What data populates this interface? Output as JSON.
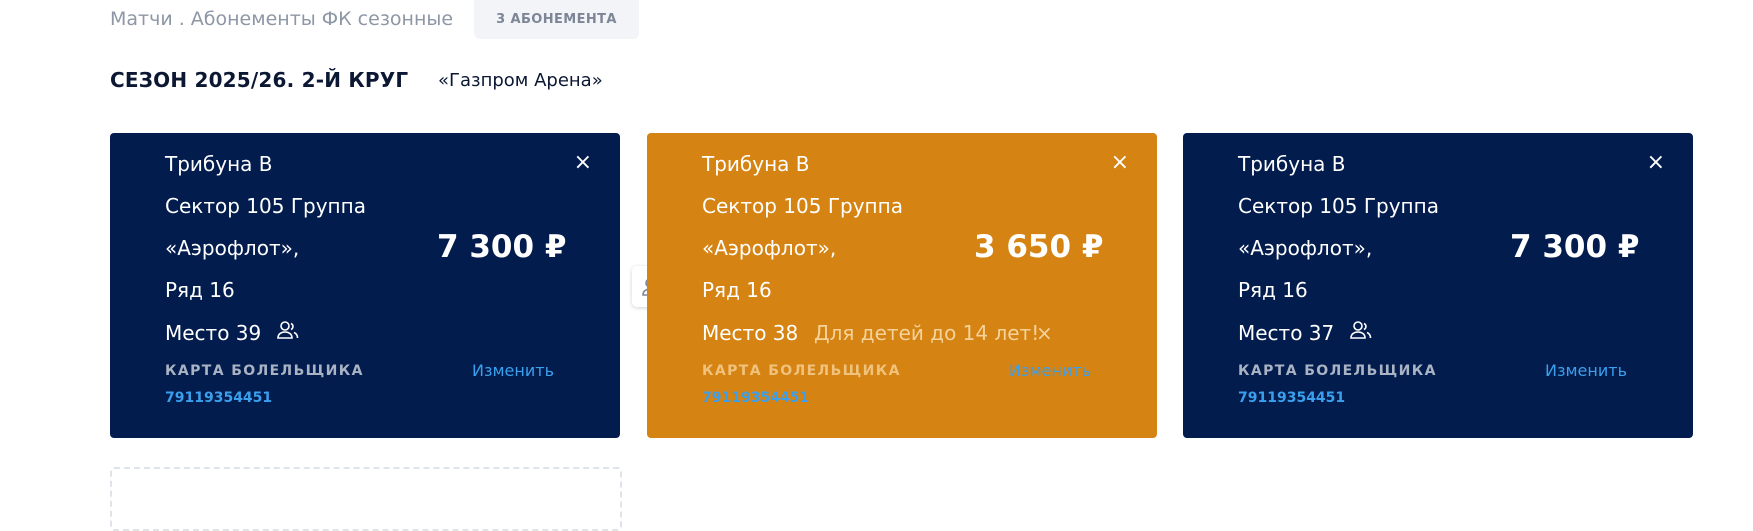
{
  "header": {
    "breadcrumb": "Матчи . Абонементы ФК сезонные",
    "badge": "3 АБОНЕМЕНТА",
    "season": "СЕЗОН 2025/26. 2-Й КРУГ",
    "venue": "«Газпром Арена»"
  },
  "colors": {
    "navy": "#031c4e",
    "orange": "#d58312",
    "link": "#3aa0ee"
  },
  "cards": [
    {
      "stand": "Трибуна В",
      "sector": "Сектор 105 Группа",
      "group": "«Аэрофлот»,",
      "row": "Ряд 16",
      "seat": "Место 39",
      "price": "7 300 ₽",
      "close": "×",
      "fan_label": "КАРТА БОЛЕЛЬЩИКА",
      "phone": "79119354451",
      "change": "Изменить"
    },
    {
      "stand": "Трибуна В",
      "sector": "Сектор 105 Группа",
      "group": "«Аэрофлот»,",
      "row": "Ряд 16",
      "seat": "Место 38",
      "price": "3 650 ₽",
      "close": "×",
      "child_note": "Для детей до 14 лет!",
      "child_close": "×",
      "fan_label": "КАРТА БОЛЕЛЬЩИКА",
      "phone": "79119354451",
      "change": "Изменить"
    },
    {
      "stand": "Трибуна В",
      "sector": "Сектор 105 Группа",
      "group": "«Аэрофлот»,",
      "row": "Ряд 16",
      "seat": "Место 37",
      "price": "7 300 ₽",
      "close": "×",
      "fan_label": "КАРТА БОЛЕЛЬЩИКА",
      "phone": "79119354451",
      "change": "Изменить"
    }
  ],
  "icons": {
    "person": "person-icon",
    "swap": "people-swap-icon"
  }
}
